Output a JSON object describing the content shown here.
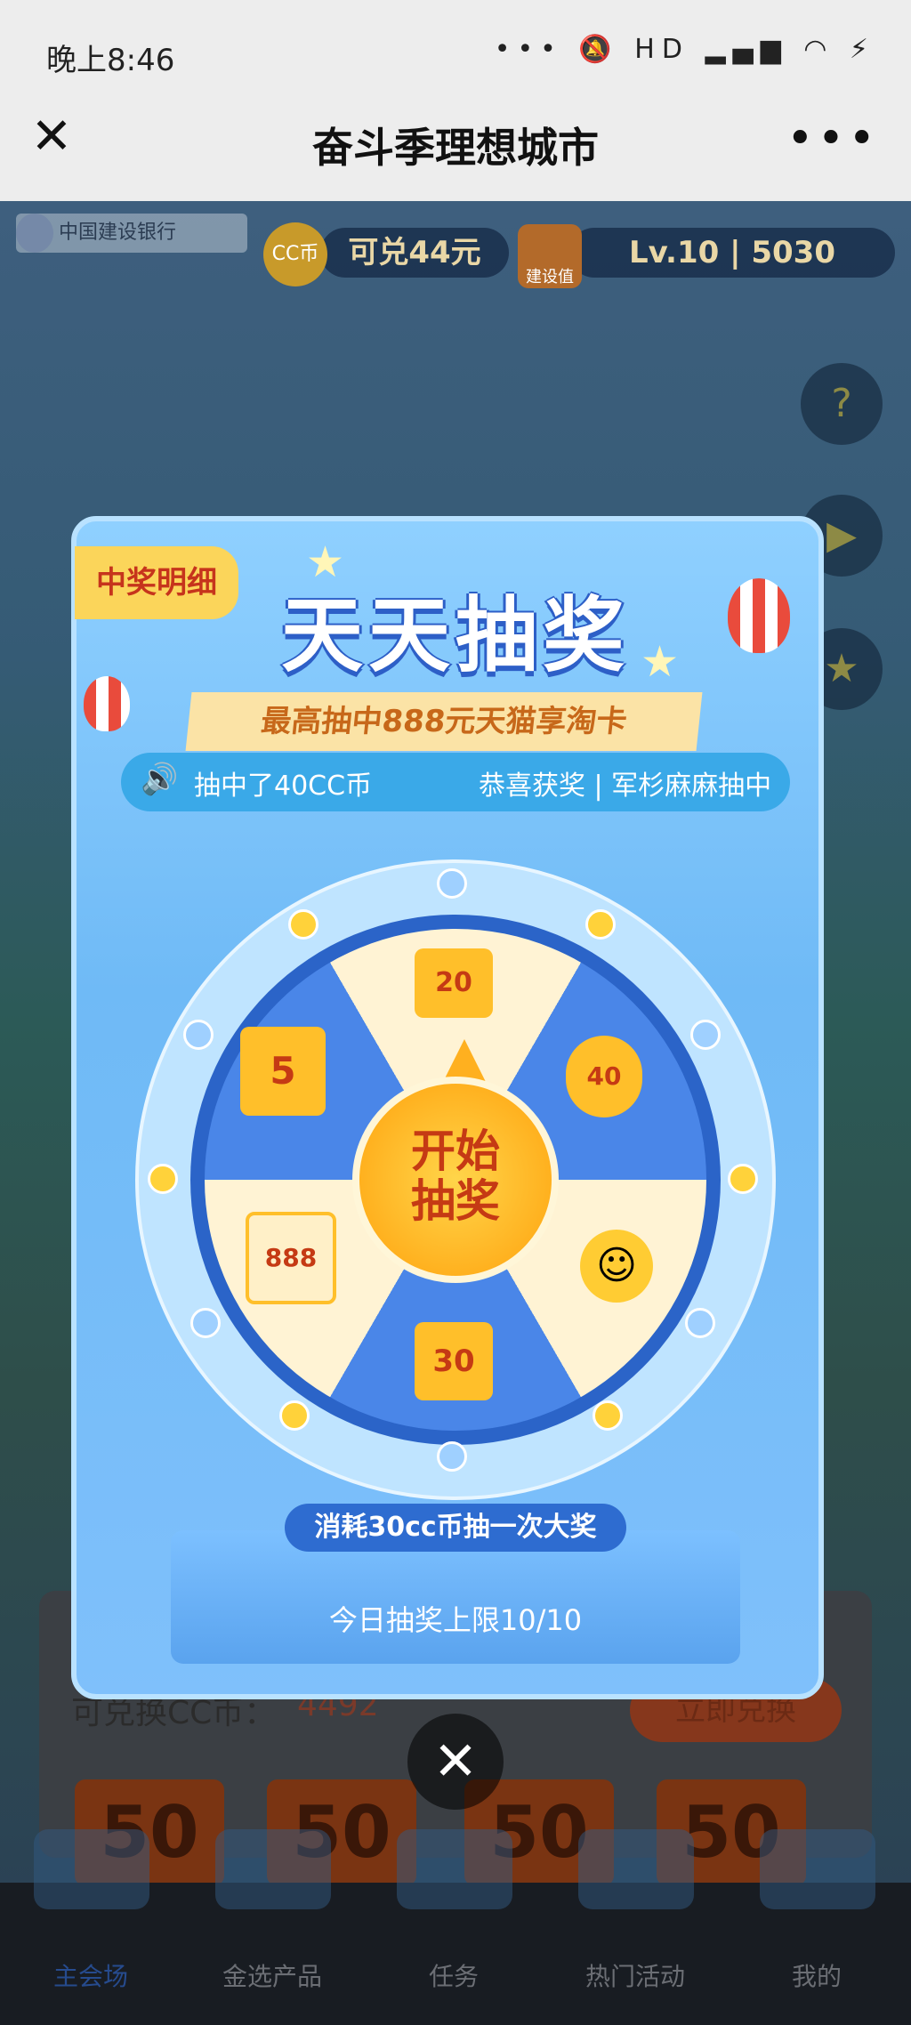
{
  "status_bar": {
    "time": "晚上8:46",
    "icons": "••• 🔕 HD ▂▄▆ ◠ ⚡"
  },
  "header": {
    "title": "奋斗季理想城市",
    "close": "✕",
    "more": "•••"
  },
  "game_header": {
    "bank_name": "中国建设银行",
    "cc_badge": "CC币",
    "cc_value": "可兑44元",
    "build_badge": "建设值",
    "level_value": "Lv.10 | 5030"
  },
  "side_buttons": {
    "help": "?",
    "play": "▶",
    "star": "★"
  },
  "modal": {
    "detail_tab": "中奖明细",
    "headline": "天天抽奖",
    "ribbon": "最高抽中888元天猫享淘卡",
    "ticker_left": "抽中了40CC币",
    "ticker_right": "恭喜获奖 | 军杉麻麻抽中",
    "start_button": "开始\n抽奖",
    "cost_label": "消耗30cc币抽一次大奖",
    "limit_label": "今日抽奖上限10/10",
    "close": "✕",
    "prizes": {
      "top": "20",
      "top_right": "40",
      "right": "☺",
      "bottom": "30",
      "bottom_left": "888",
      "top_left": "5"
    }
  },
  "exchange": {
    "label": "可兑换CC币：",
    "value": "4492",
    "button": "立即兑换",
    "coupons": [
      "50",
      "50",
      "50",
      "50"
    ]
  },
  "bottom_nav": [
    "主会场",
    "金选产品",
    "任务",
    "热门活动",
    "我的"
  ]
}
